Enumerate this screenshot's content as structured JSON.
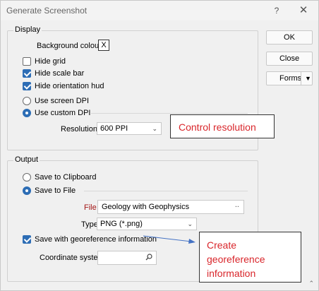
{
  "window": {
    "title": "Generate Screenshot",
    "help_glyph": "?",
    "close_glyph": "✕"
  },
  "display": {
    "group_title": "Display",
    "background_colour_label": "Background colour",
    "background_colour_value": "X",
    "hide_grid": {
      "label": "Hide grid",
      "checked": false
    },
    "hide_scale_bar": {
      "label": "Hide scale bar",
      "checked": true
    },
    "hide_orientation_hud": {
      "label": "Hide orientation hud",
      "checked": true
    },
    "use_screen_dpi": {
      "label": "Use screen DPI",
      "selected": false
    },
    "use_custom_dpi": {
      "label": "Use custom DPI",
      "selected": true
    },
    "resolution_label": "Resolution",
    "resolution_value": "600 PPI"
  },
  "output": {
    "group_title": "Output",
    "save_to_clipboard": {
      "label": "Save to Clipboard",
      "selected": false
    },
    "save_to_file": {
      "label": "Save to File",
      "selected": true
    },
    "file_label": "File",
    "file_value": "Geology with Geophysics",
    "file_browse": "..",
    "type_label": "Type",
    "type_value": "PNG (*.png)",
    "save_georef": {
      "label": "Save with georeference information",
      "checked": true
    },
    "coordinate_system_label": "Coordinate system",
    "coordinate_system_value": ""
  },
  "buttons": {
    "ok": "OK",
    "close": "Close",
    "forms": "Forms"
  },
  "annotations": {
    "control_resolution": "Control resolution",
    "create_georeference_line1": "Create",
    "create_georeference_line2": "georeference",
    "create_georeference_line3": "information"
  },
  "colors": {
    "accent": "#2d6db5",
    "required_label": "#a31515",
    "annotation_text": "#d9262b",
    "arrow": "#4472c4"
  }
}
